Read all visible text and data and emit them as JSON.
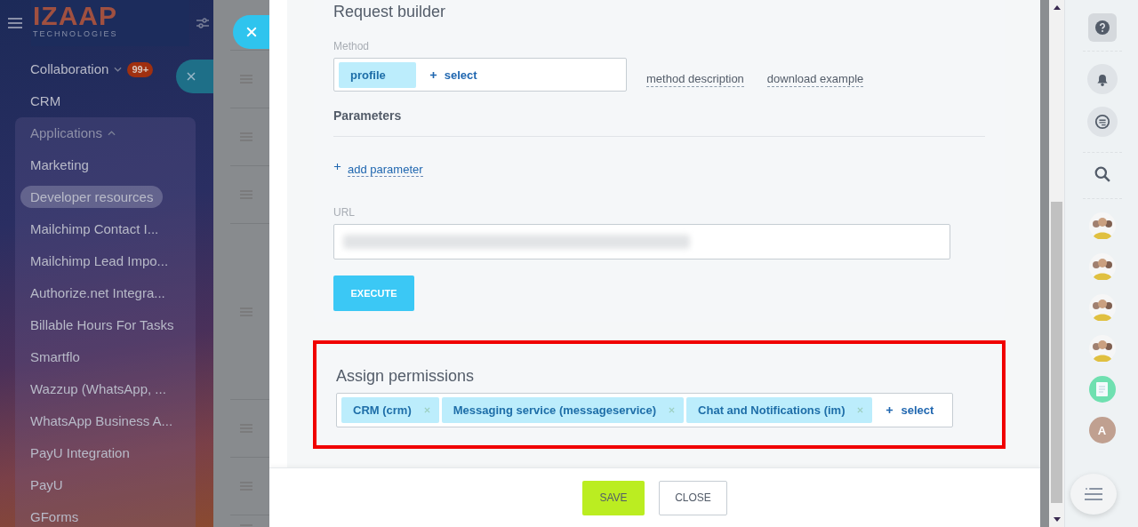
{
  "sidebar": {
    "logo": {
      "name": "IZAAP",
      "tagline": "TECHNOLOGIES"
    },
    "items": [
      {
        "label": "Collaboration",
        "kind": "group",
        "expanded": false,
        "badge": "99+"
      },
      {
        "label": "CRM",
        "kind": "link",
        "selected": false
      },
      {
        "label": "Applications",
        "kind": "group",
        "expanded": true,
        "children": [
          {
            "label": "Marketing",
            "selected": false
          },
          {
            "label": "Developer resources",
            "selected": true
          },
          {
            "label": "Mailchimp Contact I...",
            "selected": false
          },
          {
            "label": "Mailchimp Lead Impo...",
            "selected": false
          },
          {
            "label": "Authorize.net Integra...",
            "selected": false
          },
          {
            "label": "Billable Hours For Tasks",
            "selected": false
          },
          {
            "label": "Smartflo",
            "selected": false
          },
          {
            "label": "Wazzup (WhatsApp, ...",
            "selected": false
          },
          {
            "label": "WhatsApp Business A...",
            "selected": false
          },
          {
            "label": "PayU Integration",
            "selected": false
          },
          {
            "label": "PayU",
            "selected": false
          },
          {
            "label": "GForms",
            "selected": false
          }
        ]
      }
    ]
  },
  "request_builder": {
    "title": "Request builder",
    "method": {
      "label": "Method",
      "tags": [
        "profile"
      ],
      "add_label": "select"
    },
    "links": [
      "method description",
      "download example"
    ],
    "parameters_title": "Parameters",
    "add_parameter": "add parameter",
    "url": {
      "label": "URL"
    },
    "execute": "EXECUTE"
  },
  "permissions": {
    "title": "Assign permissions",
    "highlighted": true,
    "tags": [
      "CRM (crm)",
      "Messaging service (messageservice)",
      "Chat and Notifications (im)"
    ],
    "add_label": "select"
  },
  "footer": {
    "buttons": [
      {
        "label": "SAVE",
        "kind": "primary"
      },
      {
        "label": "CLOSE",
        "kind": "secondary"
      }
    ]
  },
  "right_panel": {
    "contacts": [
      {
        "kind": "group"
      },
      {
        "kind": "group"
      },
      {
        "kind": "group"
      },
      {
        "kind": "group"
      },
      {
        "kind": "document"
      },
      {
        "kind": "initial",
        "initial": "A"
      }
    ]
  }
}
